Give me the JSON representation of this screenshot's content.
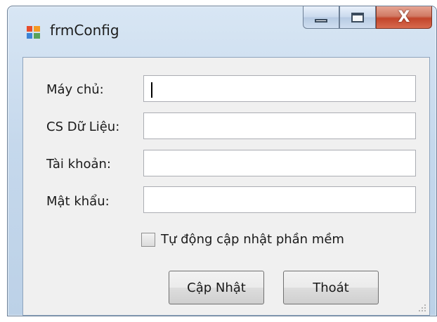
{
  "window": {
    "title": "frmConfig",
    "app_icon": "form-app-icon",
    "buttons": {
      "minimize": "minimize-icon",
      "maximize": "maximize-icon",
      "close": "close-icon",
      "close_glyph": "X"
    }
  },
  "form": {
    "fields": [
      {
        "label": "Máy chủ:",
        "value": "",
        "focused": true
      },
      {
        "label": "CS Dữ Liệu:",
        "value": ""
      },
      {
        "label": "Tài khoản:",
        "value": ""
      },
      {
        "label": "Mật khẩu:",
        "value": ""
      }
    ],
    "auto_update": {
      "label": "Tự động cập nhật phần mềm",
      "checked": false
    },
    "buttons": {
      "update": "Cập Nhật",
      "exit": "Thoát"
    }
  },
  "colors": {
    "close_button": "#c2452b",
    "client_background": "#f0f0f0",
    "frame": "#bcd1e7"
  }
}
